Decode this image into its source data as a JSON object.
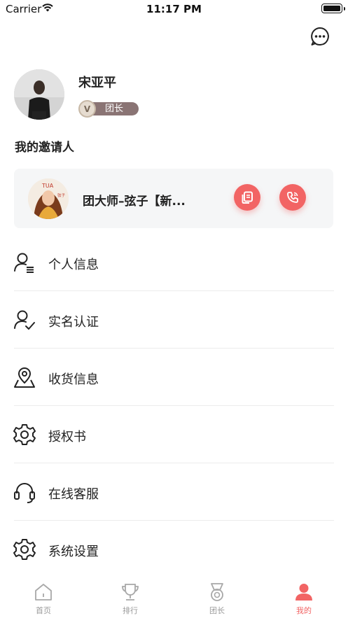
{
  "status_bar": {
    "carrier": "Carrier",
    "time": "11:17 PM"
  },
  "profile": {
    "name": "宋亚平",
    "role": "团长",
    "role_badge_letter": "V"
  },
  "inviter_section": {
    "title": "我的邀请人"
  },
  "inviter": {
    "name": "团大师–弦子【新...",
    "avatar_text": "TUA",
    "avatar_caption": "弦子"
  },
  "menu": [
    {
      "label": "个人信息",
      "icon": "user-list-icon"
    },
    {
      "label": "实名认证",
      "icon": "user-check-icon"
    },
    {
      "label": "收货信息",
      "icon": "location-pin-icon"
    },
    {
      "label": "授权书",
      "icon": "gear-icon"
    },
    {
      "label": "在线客服",
      "icon": "headset-icon"
    },
    {
      "label": "系统设置",
      "icon": "gear-icon"
    }
  ],
  "tabs": [
    {
      "label": "首页",
      "icon": "home-icon",
      "active": false
    },
    {
      "label": "排行",
      "icon": "trophy-icon",
      "active": false
    },
    {
      "label": "团长",
      "icon": "medal-icon",
      "active": false
    },
    {
      "label": "我的",
      "icon": "user-icon",
      "active": true
    }
  ],
  "colors": {
    "accent": "#f26464",
    "badge": "#8a7474",
    "text": "#222222",
    "inactive": "#9a9a9a"
  }
}
